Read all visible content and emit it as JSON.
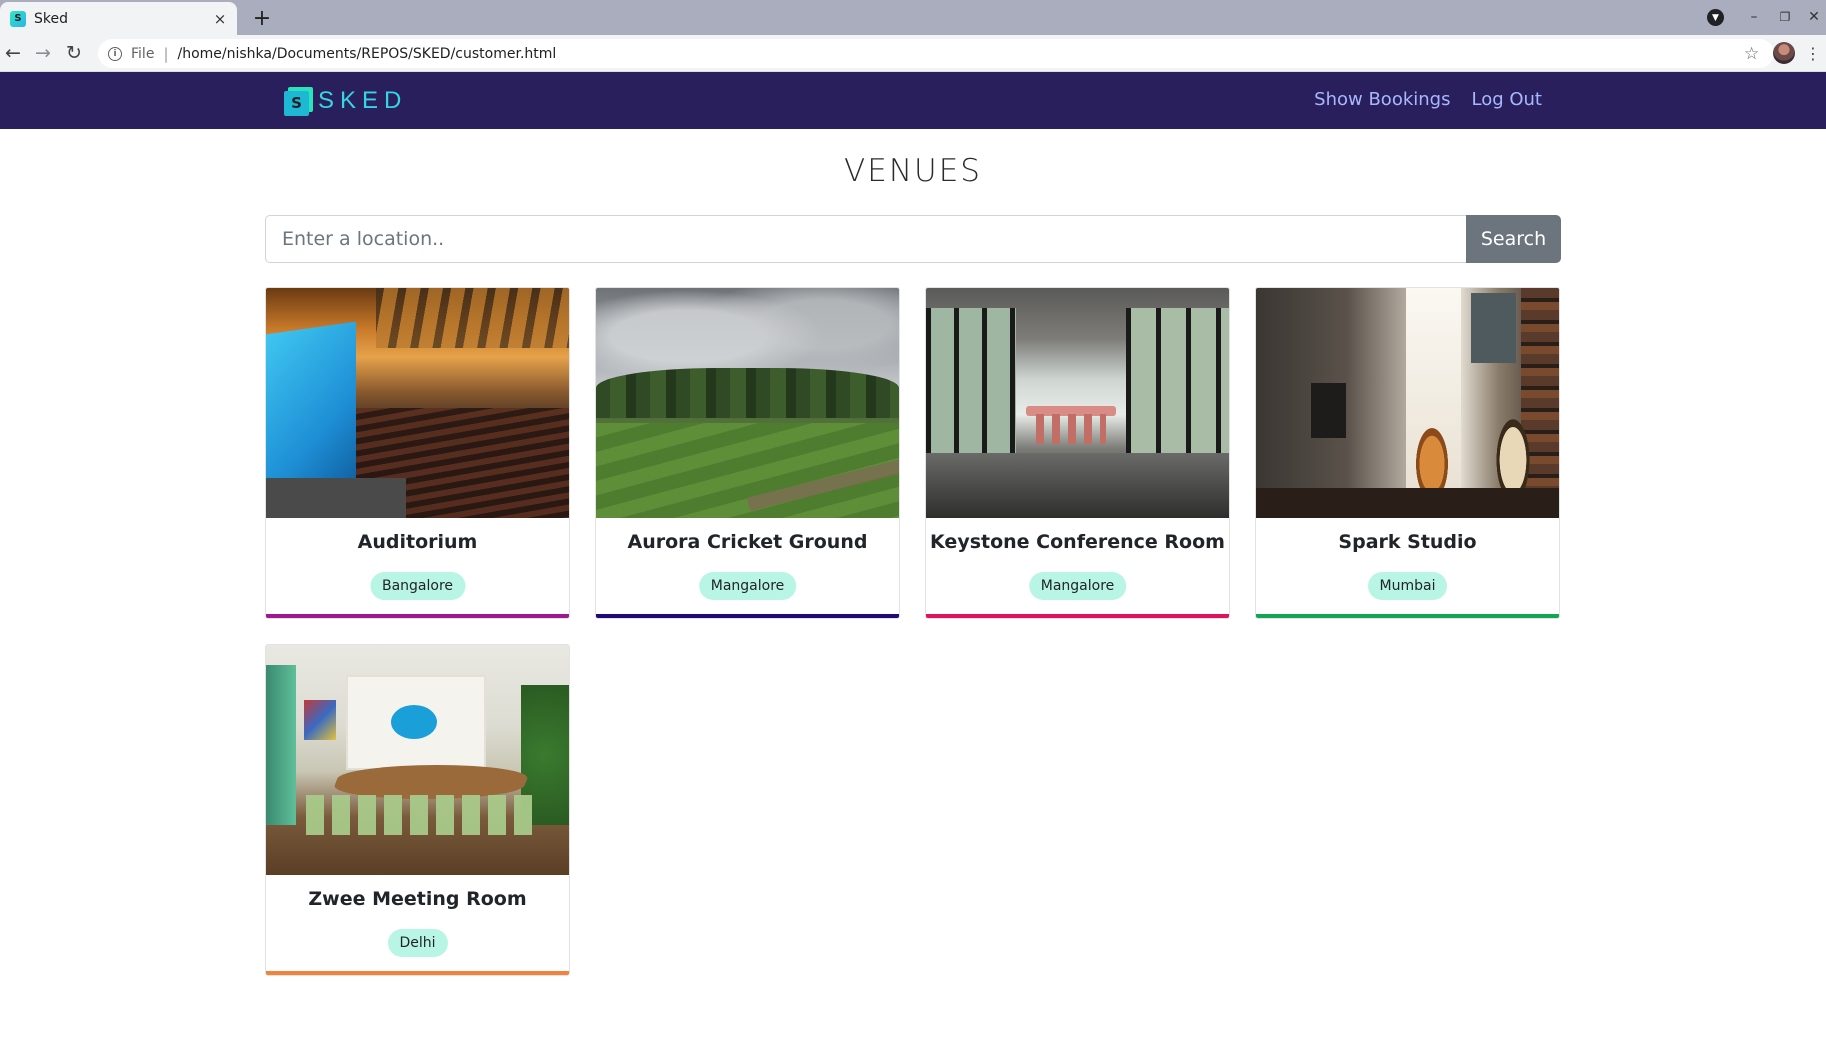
{
  "browser": {
    "tab_title": "Sked",
    "tab_close": "×",
    "new_tab": "+",
    "scheme_label": "File",
    "url": "/home/nishka/Documents/REPOS/SKED/customer.html"
  },
  "navbar": {
    "brand_letter": "S",
    "brand_name": "SKED",
    "links": [
      {
        "label": "Show Bookings"
      },
      {
        "label": "Log Out"
      }
    ]
  },
  "page": {
    "title": "VENUES",
    "search_placeholder": "Enter a location..",
    "search_value": "",
    "search_button": "Search"
  },
  "venues": [
    {
      "name": "Auditorium",
      "location": "Bangalore",
      "accent": "#a0188f"
    },
    {
      "name": "Aurora Cricket Ground",
      "location": "Mangalore",
      "accent": "#1f0a78"
    },
    {
      "name": "Keystone Conference Room",
      "location": "Mangalore",
      "accent": "#e0115f"
    },
    {
      "name": "Spark Studio",
      "location": "Mumbai",
      "accent": "#11a556"
    },
    {
      "name": "Zwee Meeting Room",
      "location": "Delhi",
      "accent": "#f0843c"
    }
  ],
  "colors": {
    "navbar_bg": "#291f5c",
    "brand": "#34d6e3",
    "nav_link": "#a8b8ff",
    "badge_bg": "#b9f5e4",
    "search_button_bg": "#6c757d"
  },
  "icons": {
    "back": "arrow-left-icon",
    "forward": "arrow-right-icon",
    "reload": "reload-icon",
    "info": "info-icon",
    "star": "star-icon",
    "menu": "kebab-menu-icon"
  }
}
